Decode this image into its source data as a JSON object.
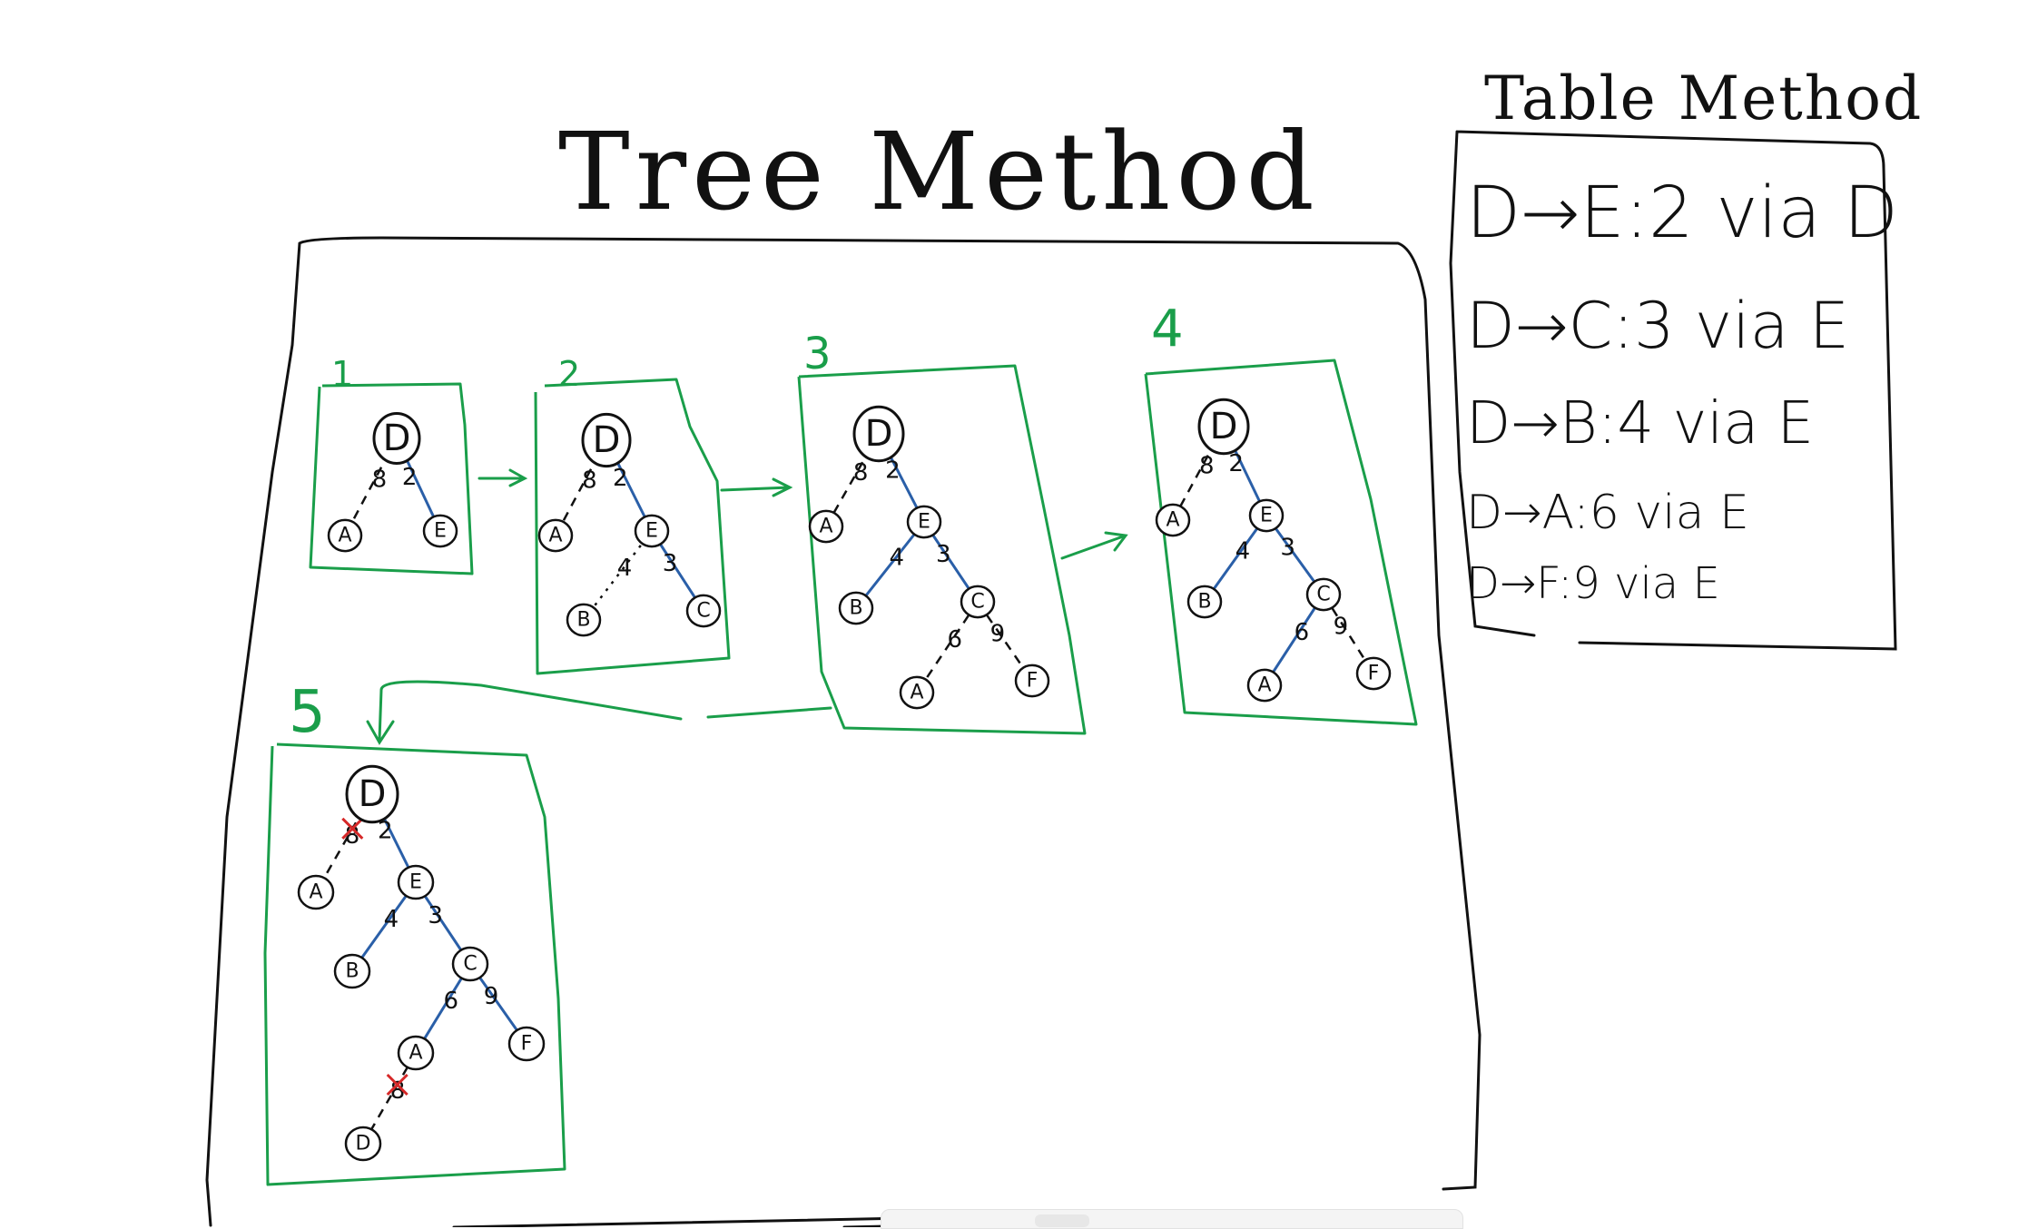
{
  "titles": {
    "tree": "Tree Method",
    "table": "Table Method"
  },
  "table_rows": [
    "D→E:2 via D",
    "D→C:3 via E",
    "D→B:4 via E",
    "D→A:6 via E",
    "D→F:9 via E"
  ],
  "step_labels": [
    "1",
    "2",
    "3",
    "4",
    "5"
  ],
  "trees": [
    {
      "step": "1",
      "nodes": [
        {
          "id": "D",
          "label": "D",
          "root": true
        },
        {
          "id": "A",
          "label": "A"
        },
        {
          "id": "E",
          "label": "E"
        }
      ],
      "edges": [
        {
          "from": "D",
          "to": "A",
          "weight": "8",
          "style": "dashed"
        },
        {
          "from": "D",
          "to": "E",
          "weight": "2",
          "style": "solid-blue"
        }
      ]
    },
    {
      "step": "2",
      "nodes": [
        {
          "id": "D",
          "label": "D",
          "root": true
        },
        {
          "id": "A",
          "label": "A"
        },
        {
          "id": "E",
          "label": "E"
        },
        {
          "id": "B",
          "label": "B"
        },
        {
          "id": "C",
          "label": "C"
        }
      ],
      "edges": [
        {
          "from": "D",
          "to": "A",
          "weight": "8",
          "style": "dashed"
        },
        {
          "from": "D",
          "to": "E",
          "weight": "2",
          "style": "solid-blue"
        },
        {
          "from": "E",
          "to": "B",
          "weight": "4",
          "style": "dotted"
        },
        {
          "from": "E",
          "to": "C",
          "weight": "3",
          "style": "solid-blue"
        }
      ]
    },
    {
      "step": "3",
      "nodes": [
        {
          "id": "D",
          "label": "D",
          "root": true
        },
        {
          "id": "A",
          "label": "A"
        },
        {
          "id": "E",
          "label": "E"
        },
        {
          "id": "B",
          "label": "B"
        },
        {
          "id": "C",
          "label": "C"
        },
        {
          "id": "A2",
          "label": "A"
        },
        {
          "id": "F",
          "label": "F"
        }
      ],
      "edges": [
        {
          "from": "D",
          "to": "A",
          "weight": "8",
          "style": "dashed"
        },
        {
          "from": "D",
          "to": "E",
          "weight": "2",
          "style": "solid-blue"
        },
        {
          "from": "E",
          "to": "B",
          "weight": "4",
          "style": "solid-blue"
        },
        {
          "from": "E",
          "to": "C",
          "weight": "3",
          "style": "solid-blue"
        },
        {
          "from": "C",
          "to": "A2",
          "weight": "6",
          "style": "dashed"
        },
        {
          "from": "C",
          "to": "F",
          "weight": "9",
          "style": "dashed"
        }
      ]
    },
    {
      "step": "4",
      "nodes": [
        {
          "id": "D",
          "label": "D",
          "root": true
        },
        {
          "id": "A",
          "label": "A"
        },
        {
          "id": "E",
          "label": "E"
        },
        {
          "id": "B",
          "label": "B"
        },
        {
          "id": "C",
          "label": "C"
        },
        {
          "id": "A2",
          "label": "A"
        },
        {
          "id": "F",
          "label": "F"
        }
      ],
      "edges": [
        {
          "from": "D",
          "to": "A",
          "weight": "8",
          "style": "dashed"
        },
        {
          "from": "D",
          "to": "E",
          "weight": "2",
          "style": "solid-blue"
        },
        {
          "from": "E",
          "to": "B",
          "weight": "4",
          "style": "solid-blue"
        },
        {
          "from": "E",
          "to": "C",
          "weight": "3",
          "style": "solid-blue"
        },
        {
          "from": "C",
          "to": "A2",
          "weight": "6",
          "style": "solid-blue"
        },
        {
          "from": "C",
          "to": "F",
          "weight": "9",
          "style": "dashed"
        }
      ]
    },
    {
      "step": "5",
      "nodes": [
        {
          "id": "D",
          "label": "D",
          "root": true
        },
        {
          "id": "A",
          "label": "A"
        },
        {
          "id": "E",
          "label": "E"
        },
        {
          "id": "B",
          "label": "B"
        },
        {
          "id": "C",
          "label": "C"
        },
        {
          "id": "A2",
          "label": "A"
        },
        {
          "id": "F",
          "label": "F"
        },
        {
          "id": "D2",
          "label": "D"
        }
      ],
      "edges": [
        {
          "from": "D",
          "to": "A",
          "weight": "8",
          "style": "dashed",
          "crossed": true
        },
        {
          "from": "D",
          "to": "E",
          "weight": "2",
          "style": "solid-blue"
        },
        {
          "from": "E",
          "to": "B",
          "weight": "4",
          "style": "solid-blue"
        },
        {
          "from": "E",
          "to": "C",
          "weight": "3",
          "style": "solid-blue"
        },
        {
          "from": "C",
          "to": "A2",
          "weight": "6",
          "style": "solid-blue"
        },
        {
          "from": "C",
          "to": "F",
          "weight": "9",
          "style": "solid-blue"
        },
        {
          "from": "A2",
          "to": "D2",
          "weight": "8",
          "style": "dashed",
          "crossed": true
        }
      ]
    }
  ],
  "colors": {
    "ink": "#111111",
    "frame_green": "#1a9e4a",
    "edge_blue": "#2a5fa8",
    "cross_red": "#d62828"
  }
}
